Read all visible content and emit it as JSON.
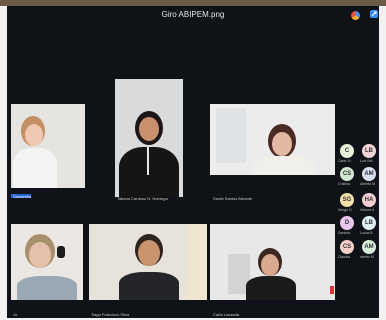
{
  "window": {
    "title": "Giro ABIPEM.png"
  },
  "participants": [
    {
      "name": "Samantha",
      "highlighted": true
    },
    {
      "name": "Tatiana Cardoso N. Nobrega",
      "highlighted": false
    },
    {
      "name": "Sarah Santos Abrante",
      "highlighted": false
    },
    {
      "name": "Jo",
      "highlighted": false
    },
    {
      "name": "Tiago Francisco Silva",
      "highlighted": false
    },
    {
      "name": "Carla Lousada",
      "highlighted": false
    }
  ],
  "avatars": [
    {
      "initials": "C",
      "label": "Carla Vl.",
      "color": "#e7f2d8"
    },
    {
      "initials": "LB",
      "label": "Luiz Bel.",
      "color": "#f6d3d9"
    },
    {
      "initials": "CS",
      "label": "Cristina",
      "color": "#d2e7d0"
    },
    {
      "initials": "AM",
      "label": "Alberto M",
      "color": "#d8dff2"
    },
    {
      "initials": "SG",
      "label": "Sérgio G",
      "color": "#f3e0a8"
    },
    {
      "initials": "HA",
      "label": "Helena A",
      "color": "#f4cdd3"
    },
    {
      "initials": "D",
      "label": "Daniela",
      "color": "#e9c7ec"
    },
    {
      "initials": "LB",
      "label": "Lucas B",
      "color": "#dbeef2"
    },
    {
      "initials": "CS",
      "label": "Claudia",
      "color": "#f6d0c8"
    },
    {
      "initials": "AM",
      "label": "aberto M",
      "color": "#d6ecd6"
    }
  ],
  "colors": {
    "background": "#0f1317",
    "highlight": "#1f63d6"
  }
}
